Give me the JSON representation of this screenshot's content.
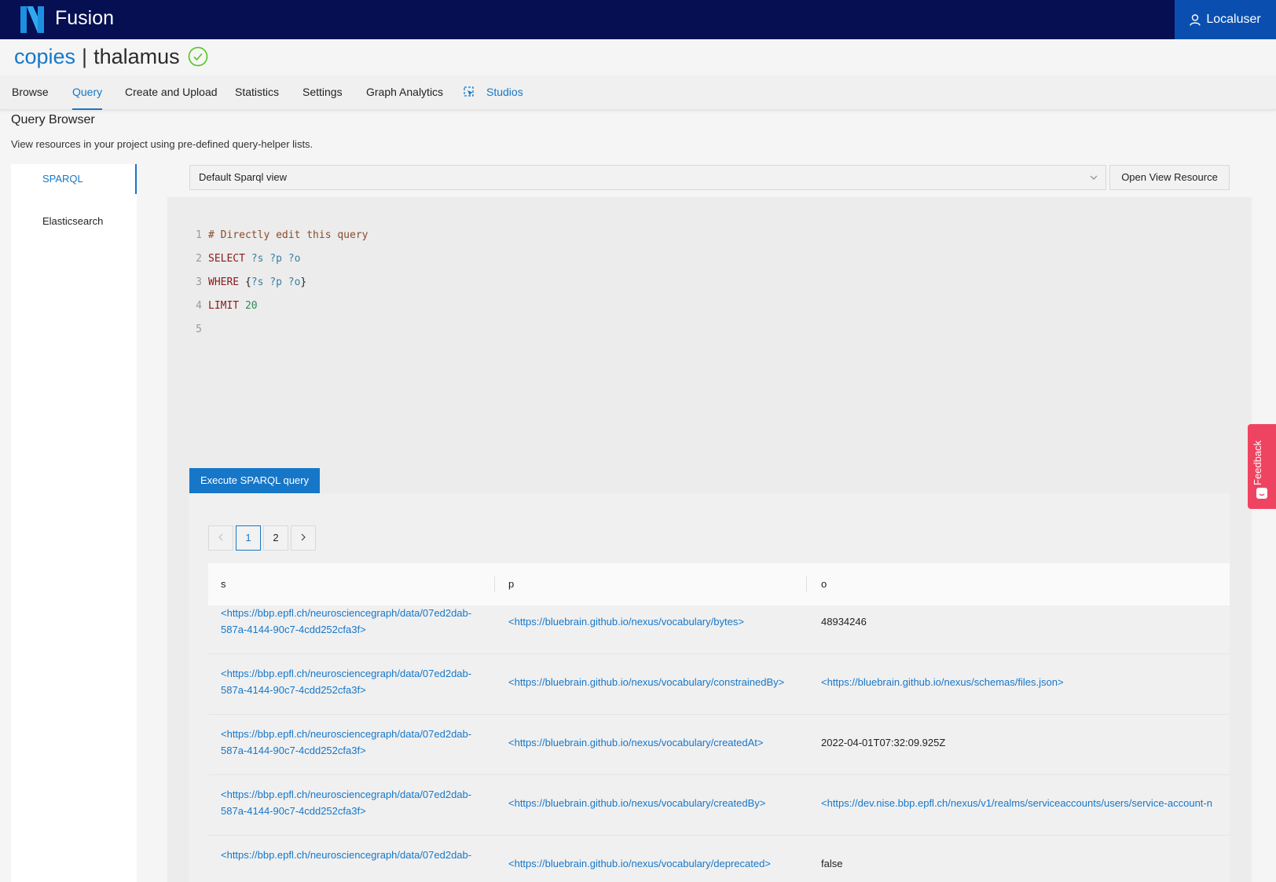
{
  "app": {
    "name": "Fusion",
    "user": "Localuser"
  },
  "breadcrumb": {
    "org": "copies",
    "separator": "|",
    "project": "thalamus"
  },
  "tabs": [
    {
      "label": "Browse"
    },
    {
      "label": "Query"
    },
    {
      "label": "Create and Upload"
    },
    {
      "label": "Statistics"
    },
    {
      "label": "Settings"
    },
    {
      "label": "Graph Analytics"
    },
    {
      "label": "Studios"
    }
  ],
  "page": {
    "title": "Query Browser",
    "description": "View resources in your project using pre-defined query-helper lists."
  },
  "sidebar": {
    "items": [
      {
        "label": "SPARQL"
      },
      {
        "label": "Elasticsearch"
      }
    ]
  },
  "view_select": {
    "value": "Default Sparql view"
  },
  "open_view_label": "Open View Resource",
  "editor": {
    "line_numbers": [
      "1",
      "2",
      "3",
      "4",
      "5"
    ],
    "lines": [
      [
        {
          "t": "# Directly edit this query",
          "c": "cm"
        }
      ],
      [
        {
          "t": "SELECT",
          "c": "kw"
        },
        {
          "t": " ",
          "c": ""
        },
        {
          "t": "?s ?p ?o",
          "c": "var"
        }
      ],
      [
        {
          "t": "WHERE",
          "c": "kw"
        },
        {
          "t": " {",
          "c": ""
        },
        {
          "t": "?s ?p ?o",
          "c": "var"
        },
        {
          "t": "}",
          "c": ""
        }
      ],
      [
        {
          "t": "LIMIT",
          "c": "kw"
        },
        {
          "t": " ",
          "c": ""
        },
        {
          "t": "20",
          "c": "num"
        }
      ],
      []
    ]
  },
  "execute_label": "Execute SPARQL query",
  "pager": {
    "prev": "<",
    "pages": [
      "1",
      "2"
    ],
    "current": "1",
    "next": ">"
  },
  "table": {
    "headers": [
      "s",
      "p",
      "o"
    ],
    "rows": [
      {
        "s": [
          "<https://bbp.epfl.ch/neurosciencegraph/data/07ed2dab-",
          "587a-4144-90c7-4cdd252cfa3f>"
        ],
        "p": "<https://bluebrain.github.io/nexus/vocabulary/bytes>",
        "o": "48934246",
        "o_link": false
      },
      {
        "s": [
          "<https://bbp.epfl.ch/neurosciencegraph/data/07ed2dab-",
          "587a-4144-90c7-4cdd252cfa3f>"
        ],
        "p": "<https://bluebrain.github.io/nexus/vocabulary/constrainedBy>",
        "o": "<https://bluebrain.github.io/nexus/schemas/files.json>",
        "o_link": true
      },
      {
        "s": [
          "<https://bbp.epfl.ch/neurosciencegraph/data/07ed2dab-",
          "587a-4144-90c7-4cdd252cfa3f>"
        ],
        "p": "<https://bluebrain.github.io/nexus/vocabulary/createdAt>",
        "o": "2022-04-01T07:32:09.925Z",
        "o_link": false
      },
      {
        "s": [
          "<https://bbp.epfl.ch/neurosciencegraph/data/07ed2dab-",
          "587a-4144-90c7-4cdd252cfa3f>"
        ],
        "p": "<https://bluebrain.github.io/nexus/vocabulary/createdBy>",
        "o": "<https://dev.nise.bbp.epfl.ch/nexus/v1/realms/serviceaccounts/users/service-account-n",
        "o_link": true
      },
      {
        "s": [
          "<https://bbp.epfl.ch/neurosciencegraph/data/07ed2dab-",
          ""
        ],
        "p": "<https://bluebrain.github.io/nexus/vocabulary/deprecated>",
        "o": "false",
        "o_link": false
      }
    ]
  },
  "feedback_label": "Feedback",
  "colors": {
    "navbar": "#050f52",
    "accent": "#1677c9",
    "user_button": "#0a4fb0",
    "feedback": "#ef4461",
    "valid": "#52c41a"
  },
  "icons": [
    "fusion-logo",
    "user-icon",
    "check-circle-icon",
    "studios-icon",
    "chevron-down-icon",
    "chevron-left-icon",
    "chevron-right-icon",
    "feedback-icon"
  ]
}
